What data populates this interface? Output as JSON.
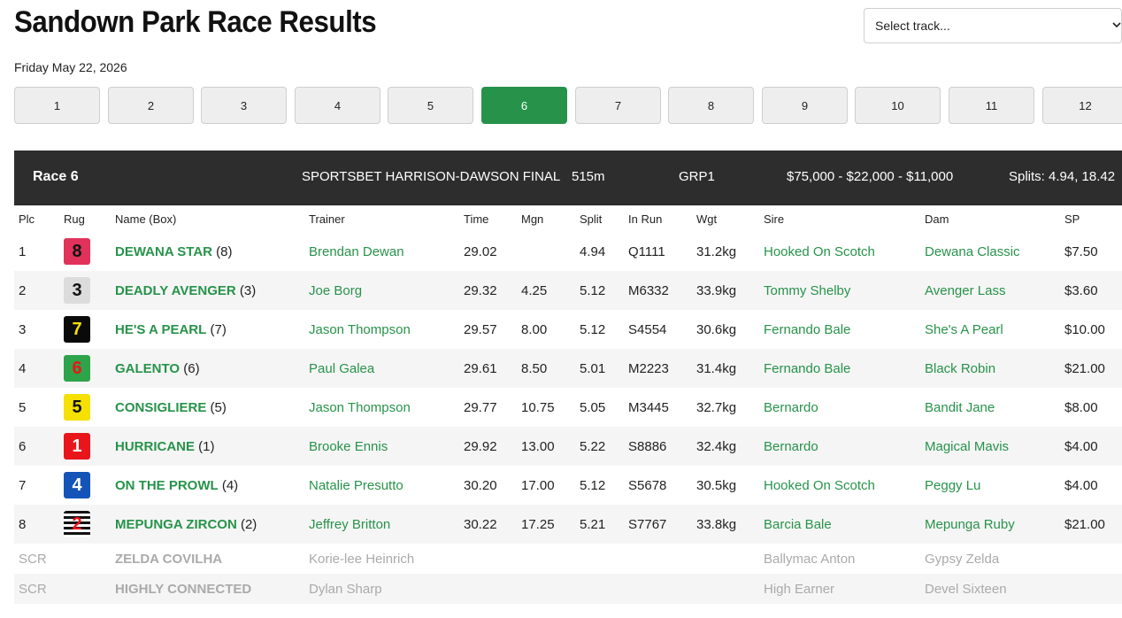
{
  "title": "Sandown Park Race Results",
  "track_select": {
    "value": "Select track..."
  },
  "date": "Friday May 22, 2026",
  "race_tabs": [
    "1",
    "2",
    "3",
    "4",
    "5",
    "6",
    "7",
    "8",
    "9",
    "10",
    "11",
    "12"
  ],
  "active_race_tab": "6",
  "race_header": {
    "race": "Race 6",
    "name": "SPORTSBET HARRISON-DAWSON FINAL",
    "distance": "515m",
    "grade": "GRP1",
    "prizes": "$75,000 - $22,000 - $11,000",
    "splits": "Splits: 4.94, 18.42"
  },
  "columns": [
    "Plc",
    "Rug",
    "Name (Box)",
    "Trainer",
    "Time",
    "Mgn",
    "Split",
    "In Run",
    "Wgt",
    "Sire",
    "Dam",
    "SP"
  ],
  "colors": {
    "accent": "#27934a",
    "header_bg": "#2d2d2d"
  },
  "results": [
    {
      "plc": "1",
      "rug": "8",
      "rug_style": "rug-8",
      "name": "DEWANA STAR",
      "box": "(8)",
      "trainer": "Brendan Dewan",
      "time": "29.02",
      "mgn": "",
      "split": "4.94",
      "inrun": "Q1111",
      "wgt": "31.2kg",
      "sire": "Hooked On Scotch",
      "dam": "Dewana Classic",
      "sp": "$7.50"
    },
    {
      "plc": "2",
      "rug": "3",
      "rug_style": "rug-3",
      "name": "DEADLY AVENGER",
      "box": "(3)",
      "trainer": "Joe Borg",
      "time": "29.32",
      "mgn": "4.25",
      "split": "5.12",
      "inrun": "M6332",
      "wgt": "33.9kg",
      "sire": "Tommy Shelby",
      "dam": "Avenger Lass",
      "sp": "$3.60"
    },
    {
      "plc": "3",
      "rug": "7",
      "rug_style": "rug-7",
      "name": "HE'S A PEARL",
      "box": "(7)",
      "trainer": "Jason Thompson",
      "time": "29.57",
      "mgn": "8.00",
      "split": "5.12",
      "inrun": "S4554",
      "wgt": "30.6kg",
      "sire": "Fernando Bale",
      "dam": "She's A Pearl",
      "sp": "$10.00"
    },
    {
      "plc": "4",
      "rug": "6",
      "rug_style": "rug-6",
      "name": "GALENTO",
      "box": "(6)",
      "trainer": "Paul Galea",
      "time": "29.61",
      "mgn": "8.50",
      "split": "5.01",
      "inrun": "M2223",
      "wgt": "31.4kg",
      "sire": "Fernando Bale",
      "dam": "Black Robin",
      "sp": "$21.00"
    },
    {
      "plc": "5",
      "rug": "5",
      "rug_style": "rug-5",
      "name": "CONSIGLIERE",
      "box": "(5)",
      "trainer": "Jason Thompson",
      "time": "29.77",
      "mgn": "10.75",
      "split": "5.05",
      "inrun": "M3445",
      "wgt": "32.7kg",
      "sire": "Bernardo",
      "dam": "Bandit Jane",
      "sp": "$8.00"
    },
    {
      "plc": "6",
      "rug": "1",
      "rug_style": "rug-1",
      "name": "HURRICANE",
      "box": "(1)",
      "trainer": "Brooke Ennis",
      "time": "29.92",
      "mgn": "13.00",
      "split": "5.22",
      "inrun": "S8886",
      "wgt": "32.4kg",
      "sire": "Bernardo",
      "dam": "Magical Mavis",
      "sp": "$4.00"
    },
    {
      "plc": "7",
      "rug": "4",
      "rug_style": "rug-4",
      "name": "ON THE PROWL",
      "box": "(4)",
      "trainer": "Natalie Presutto",
      "time": "30.20",
      "mgn": "17.00",
      "split": "5.12",
      "inrun": "S5678",
      "wgt": "30.5kg",
      "sire": "Hooked On Scotch",
      "dam": "Peggy Lu",
      "sp": "$4.00"
    },
    {
      "plc": "8",
      "rug": "2",
      "rug_style": "rug-2",
      "name": "MEPUNGA ZIRCON",
      "box": "(2)",
      "trainer": "Jeffrey Britton",
      "time": "30.22",
      "mgn": "17.25",
      "split": "5.21",
      "inrun": "S7767",
      "wgt": "33.8kg",
      "sire": "Barcia Bale",
      "dam": "Mepunga Ruby",
      "sp": "$21.00"
    }
  ],
  "scratched": [
    {
      "plc": "SCR",
      "name": "ZELDA COVILHA",
      "trainer": "Korie-lee Heinrich",
      "sire": "Ballymac Anton",
      "dam": "Gypsy Zelda"
    },
    {
      "plc": "SCR",
      "name": "HIGHLY CONNECTED",
      "trainer": "Dylan Sharp",
      "sire": "High Earner",
      "dam": "Devel Sixteen"
    }
  ]
}
